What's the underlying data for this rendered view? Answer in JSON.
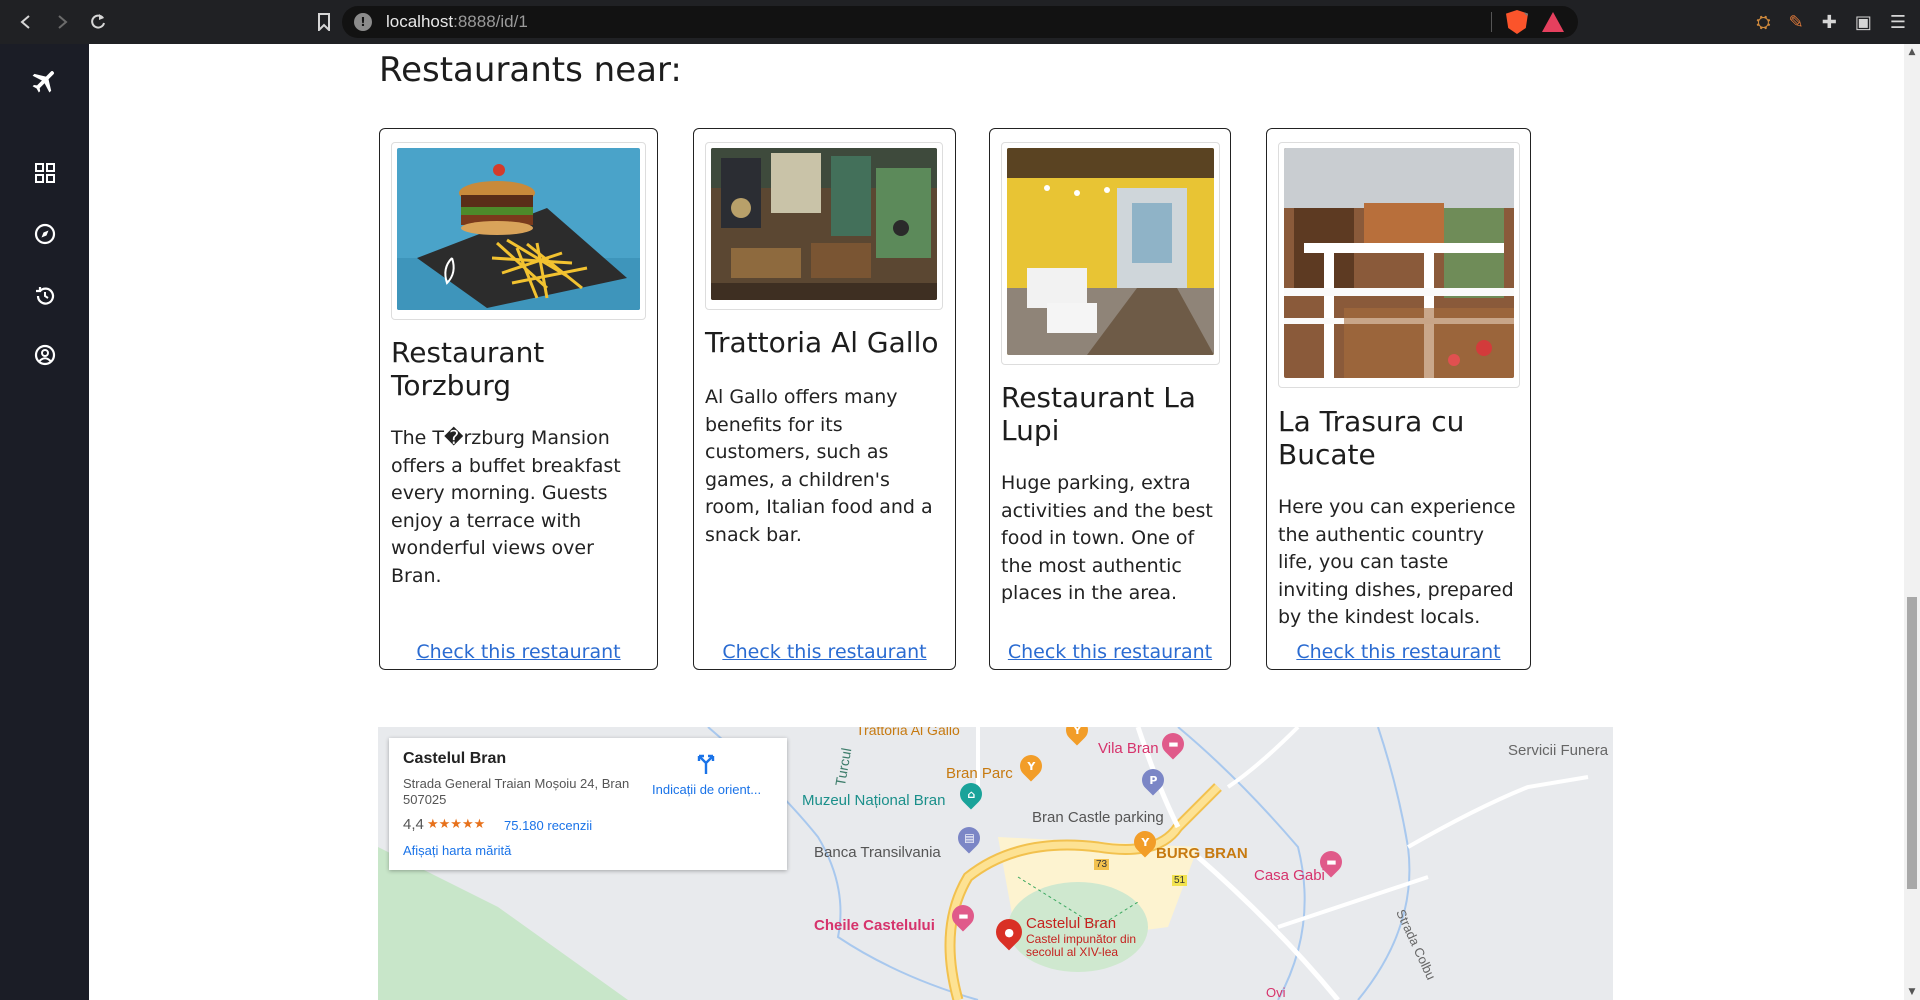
{
  "browser": {
    "url_host": "localhost",
    "url_rest": ":8888/id/1",
    "shield_count": "3",
    "alert_count": "1"
  },
  "sidebar": {
    "items": [
      "plane-logo-icon",
      "dashboard-grid-icon",
      "compass-icon",
      "history-icon",
      "account-circle-icon"
    ]
  },
  "page": {
    "heading": "Restaurants near:"
  },
  "restaurants": [
    {
      "name": "Restaurant Torzburg",
      "description": "The T�rzburg Mansion offers a buffet breakfast every morning. Guests enjoy a terrace with wonderful views over Bran.",
      "link": "Check this restaurant"
    },
    {
      "name": "Trattoria Al Gallo",
      "description": "Al Gallo offers many benefits for its customers, such as games, a children's room, Italian food and a snack bar.",
      "link": "Check this restaurant"
    },
    {
      "name": "Restaurant La Lupi",
      "description": "Huge parking, extra activities and the best food in town. One of the most authentic places in the area.",
      "link": "Check this restaurant"
    },
    {
      "name": "La Trasura cu Bucate",
      "description": "Here you can experience the authentic country life, you can taste inviting dishes, prepared by the kindest locals.",
      "link": "Check this restaurant"
    }
  ],
  "map": {
    "place_name": "Castelul Bran",
    "address": "Strada General Traian Moșoiu 24, Bran 507025",
    "rating": "4,4",
    "stars": "★★★★★",
    "reviews": "75.180 recenzii",
    "bigger_map": "Afișați harta mărită",
    "directions": "Indicații de orient...",
    "labels": {
      "trattoria": "Trattoria Al Gallo",
      "vila_bran": "Vila Bran",
      "servicii": "Servicii Funera",
      "turcul": "Turcul",
      "bran_parc": "Bran Parc",
      "muzeul": "Muzeul Național Bran",
      "parking": "Bran Castle parking",
      "banca": "Banca Transilvania",
      "burg": "BURG BRAN",
      "casa_gabi": "Casa Gabi",
      "road_73": "73",
      "road_51": "51",
      "cheile": "Cheile Castelului",
      "castel_name": "Castelul Bran",
      "castel_desc": "Castel impunător din secolul al XIV-lea",
      "strada": "Strada Colbu",
      "ovi": "Ovi"
    }
  }
}
